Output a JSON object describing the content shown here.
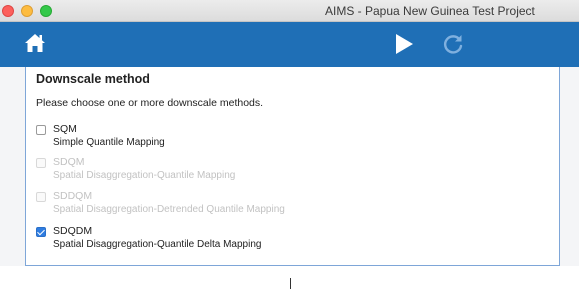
{
  "window": {
    "title": "AIMS - Papua New Guinea Test Project"
  },
  "toolbar": {
    "home_icon": "home-icon",
    "run_icon": "play-icon",
    "refresh_icon": "refresh-icon",
    "accent_color": "#1f6fb6"
  },
  "panel": {
    "title": "Downscale method",
    "instructions": "Please choose one or more downscale methods.",
    "options": [
      {
        "code": "SQM",
        "description": "Simple Quantile Mapping",
        "checked": false,
        "enabled": true
      },
      {
        "code": "SDQM",
        "description": "Spatial Disaggregation-Quantile Mapping",
        "checked": false,
        "enabled": false
      },
      {
        "code": "SDDQM",
        "description": "Spatial Disaggregation-Detrended Quantile Mapping",
        "checked": false,
        "enabled": false
      },
      {
        "code": "SDQDM",
        "description": "Spatial Disaggregation-Quantile Delta Mapping",
        "checked": true,
        "enabled": true
      }
    ]
  }
}
